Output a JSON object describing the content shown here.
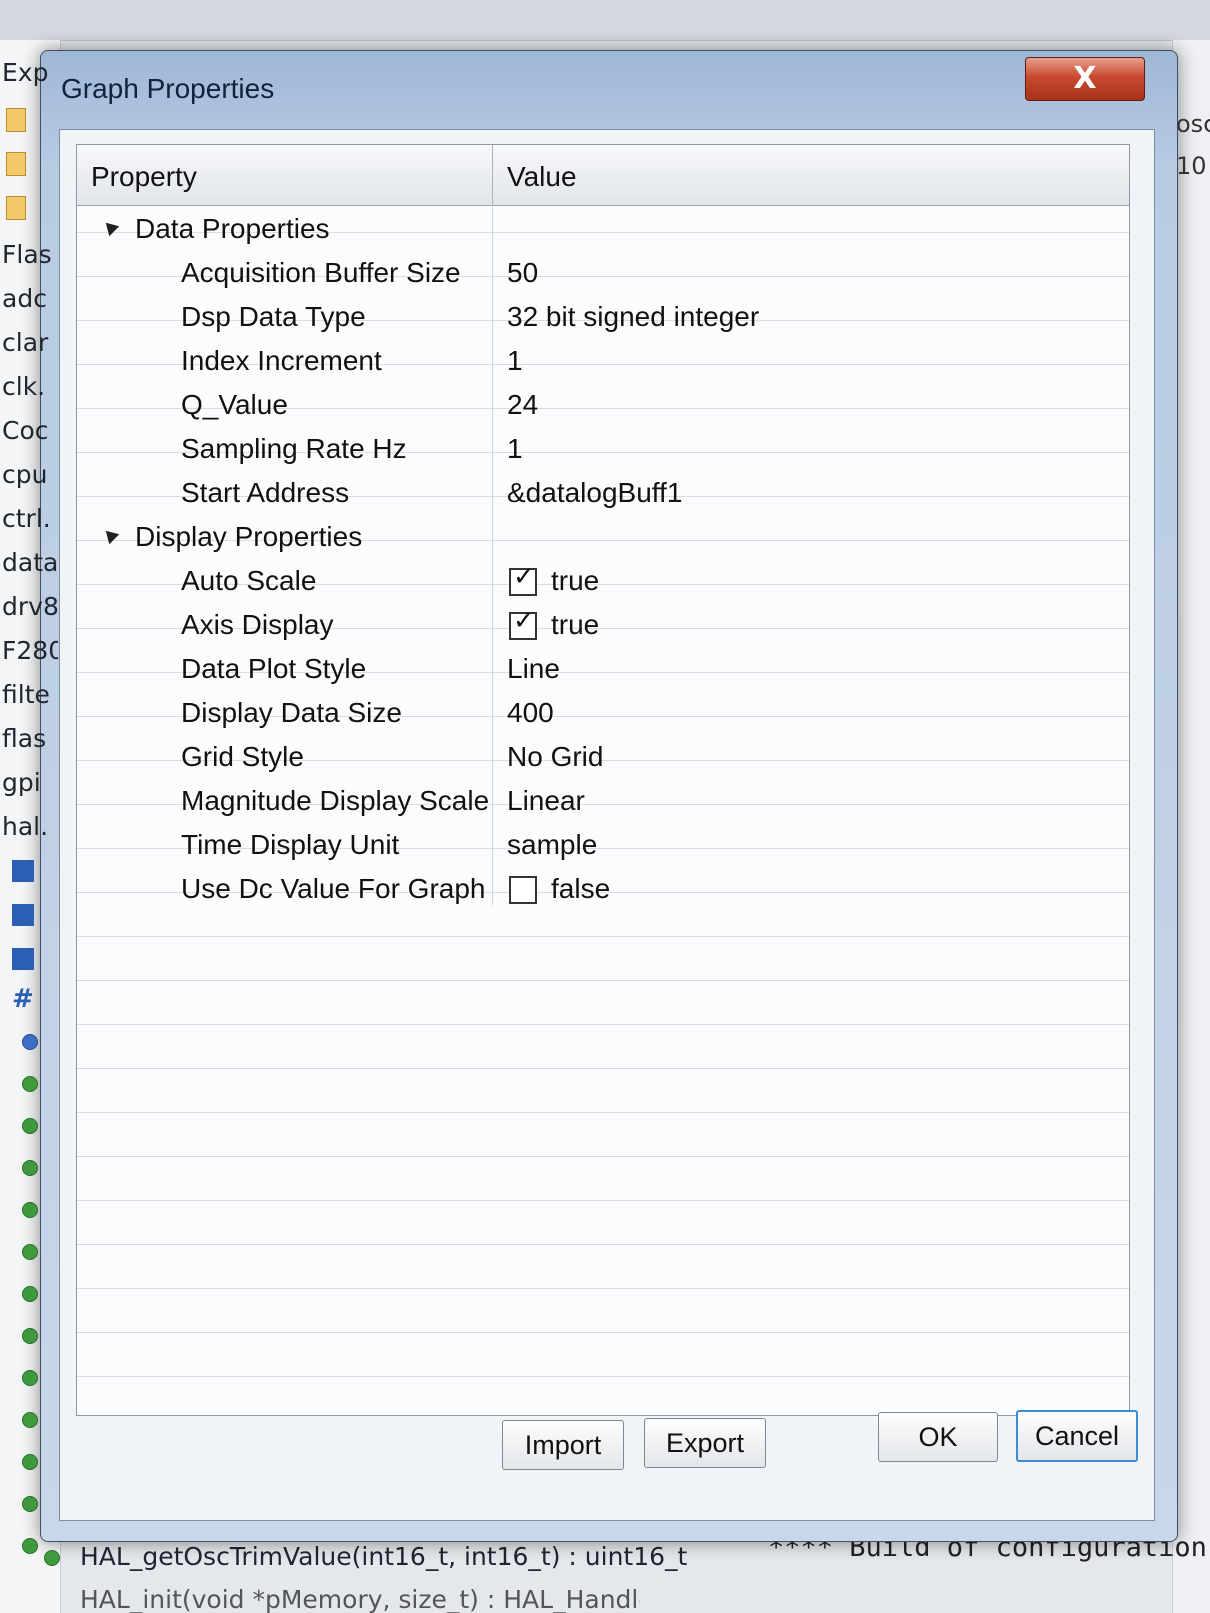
{
  "background": {
    "left_items": [
      "Exp",
      "Flas",
      "adc",
      "clar",
      "clk.",
      "Coc",
      "cpu",
      "ctrl.",
      "data",
      "drv8",
      "F280",
      "filte",
      "flas",
      "gpi",
      "hal."
    ],
    "right_items": [
      "osc",
      "10"
    ],
    "code_line": "HAL_getOscTrimValue(int16_t, int16_t) : uint16_t",
    "code_line_2": "HAL_init(void *pMemory, size_t) : HAL_Handle",
    "console_text": "**** Build of configuration"
  },
  "dialog": {
    "title": "Graph Properties",
    "close_icon": "x-icon",
    "close_glyph": "X",
    "columns": {
      "property": "Property",
      "value": "Value"
    },
    "categories": [
      {
        "label": "Data Properties",
        "rows": [
          {
            "name": "Acquisition Buffer Size",
            "value": "50"
          },
          {
            "name": "Dsp Data Type",
            "value": "32 bit signed integer"
          },
          {
            "name": "Index Increment",
            "value": "1"
          },
          {
            "name": "Q_Value",
            "value": "24"
          },
          {
            "name": "Sampling Rate Hz",
            "value": "1"
          },
          {
            "name": "Start Address",
            "value": "&datalogBuff1"
          }
        ]
      },
      {
        "label": "Display Properties",
        "rows": [
          {
            "name": "Auto Scale",
            "value": "true",
            "checkbox": true,
            "checked": true
          },
          {
            "name": "Axis Display",
            "value": "true",
            "checkbox": true,
            "checked": true
          },
          {
            "name": "Data Plot Style",
            "value": "Line"
          },
          {
            "name": "Display Data Size",
            "value": "400"
          },
          {
            "name": "Grid Style",
            "value": "No Grid"
          },
          {
            "name": "Magnitude Display Scale",
            "value": "Linear"
          },
          {
            "name": "Time Display Unit",
            "value": "sample"
          },
          {
            "name": "Use Dc Value For Graph",
            "value": "false",
            "checkbox": true,
            "checked": false
          }
        ]
      }
    ],
    "buttons": {
      "import": "Import",
      "export": "Export",
      "ok": "OK",
      "cancel": "Cancel"
    }
  },
  "colors": {
    "title_bar": "#b8cbe3",
    "close_button": "#c9492f",
    "cancel_focus": "#3b8bd6"
  }
}
